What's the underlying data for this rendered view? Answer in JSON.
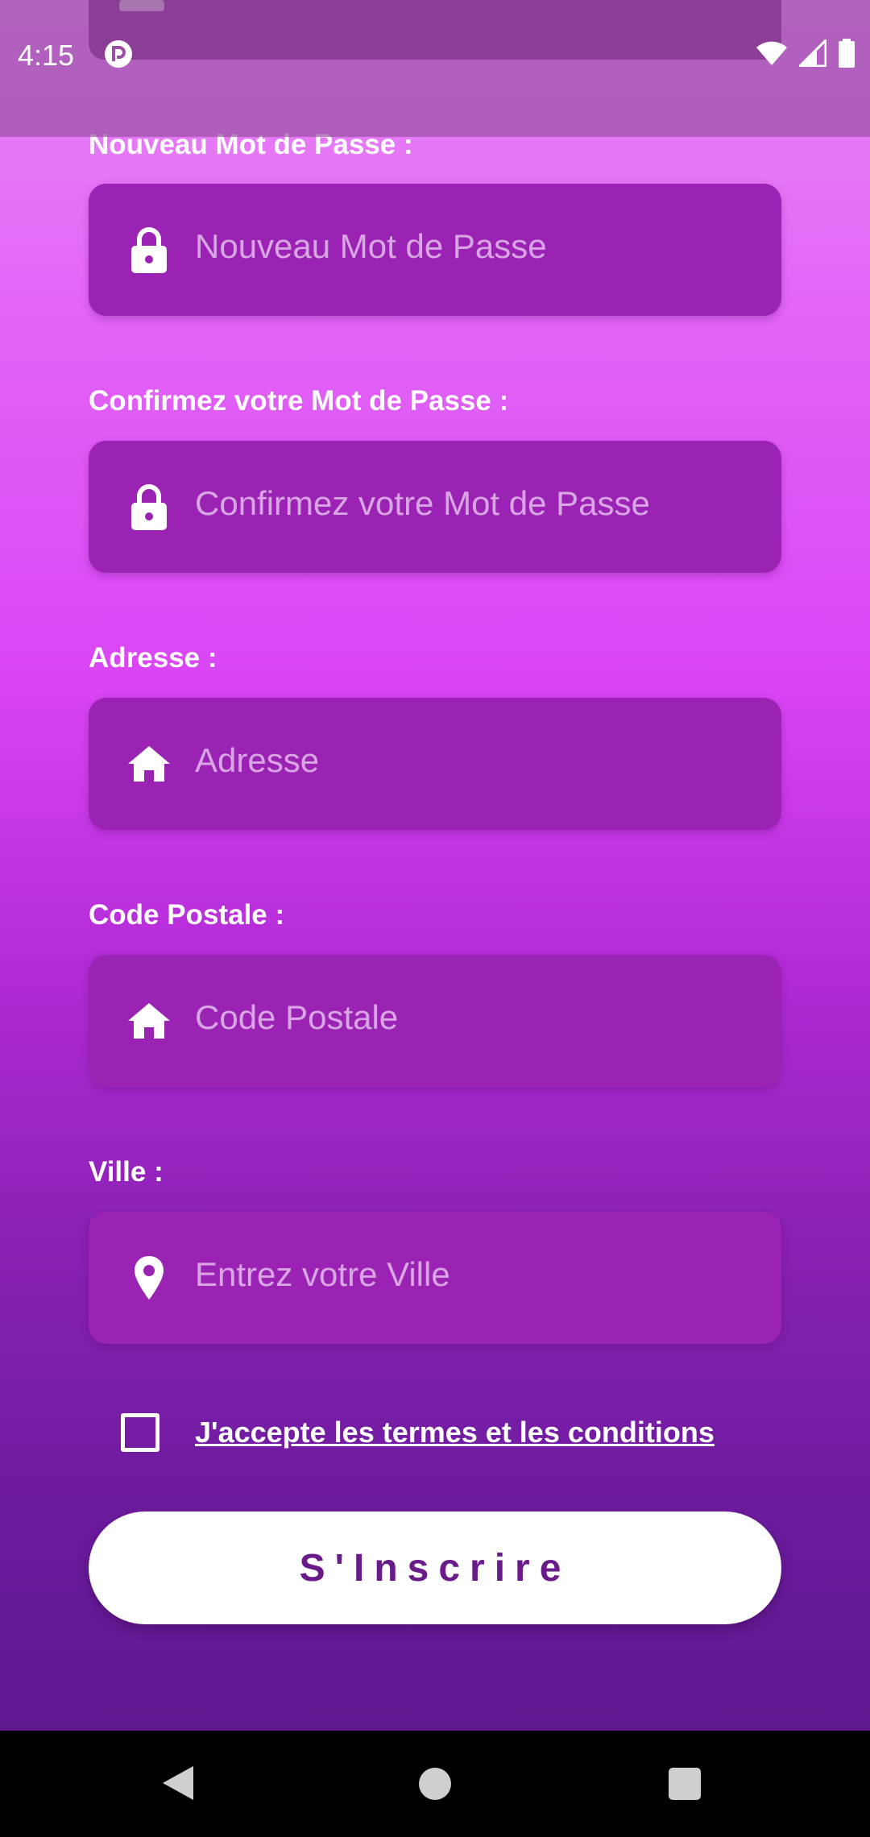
{
  "status_bar": {
    "time": "4:15"
  },
  "form": {
    "fields": [
      {
        "label": "Nouveau Mot de Passe :",
        "placeholder": "Nouveau Mot de Passe",
        "icon": "lock-icon"
      },
      {
        "label": "Confirmez votre Mot de Passe :",
        "placeholder": "Confirmez votre Mot de Passe",
        "icon": "lock-icon"
      },
      {
        "label": "Adresse :",
        "placeholder": "Adresse",
        "icon": "home-icon"
      },
      {
        "label": "Code Postale :",
        "placeholder": "Code Postale",
        "icon": "home-icon"
      },
      {
        "label": "Ville :",
        "placeholder": "Entrez votre Ville",
        "icon": "location-pin-icon"
      }
    ],
    "terms_label": "J'accepte les termes et les conditions",
    "terms_checked": false,
    "submit_label": "S'Inscrire"
  },
  "colors": {
    "field_background": "#9a23b4",
    "placeholder_text": "#d9a5e5",
    "button_text": "#6a1b8a",
    "gradient_top": "#e98bf7",
    "gradient_bottom": "#5e1890"
  }
}
